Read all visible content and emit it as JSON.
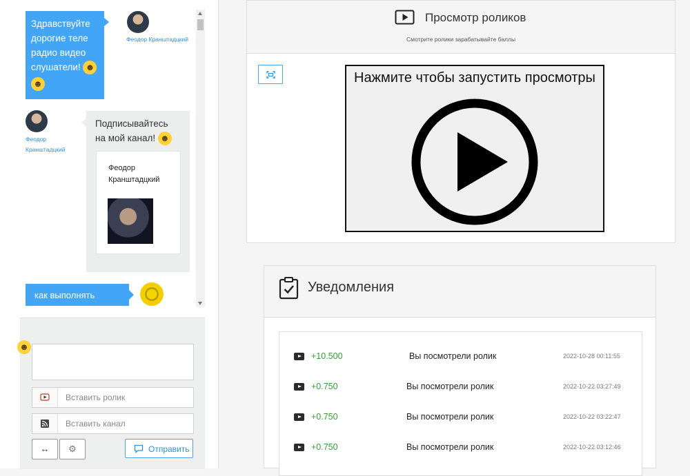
{
  "chat": {
    "messages": [
      {
        "text": "Здравствуйте дорогие теле радио видео слушатели!",
        "author": "Феодор Кранштадцкий"
      },
      {
        "text": "Подписывайтесь на мой канал!",
        "author": "Феодор Кранштадцкий",
        "card": {
          "name": "Феодор Кранштадцкий"
        }
      },
      {
        "text": "как выполнять"
      }
    ],
    "input": {
      "text_placeholder": ""
    },
    "video_input": {
      "placeholder": "Вставить ролик"
    },
    "channel_input": {
      "placeholder": "Вставить канал"
    },
    "buttons": {
      "expand": "↔",
      "settings": "⚙",
      "send": "Отправить"
    }
  },
  "video": {
    "title": "Просмотр роликов",
    "subtitle": "Смотрите ролики зарабатывайте баллы",
    "player_caption": "Нажмите чтобы запустить просмотры"
  },
  "notifications": {
    "title": "Уведомления",
    "items": [
      {
        "points": "+10.500",
        "text": "Вы посмотрели ролик",
        "date": "2022-10-28 00:11:55"
      },
      {
        "points": "+0.750",
        "text": "Вы посмотрели ролик",
        "date": "2022-10-22 03:27:49"
      },
      {
        "points": "+0.750",
        "text": "Вы посмотрели ролик",
        "date": "2022-10-22 03:22:47"
      },
      {
        "points": "+0.750",
        "text": "Вы посмотрели ролик",
        "date": "2022-10-22 03:12:46"
      }
    ]
  },
  "colors": {
    "accent": "#42a5f5",
    "points": "#3a9a3a",
    "emoji": "#ffd23a"
  },
  "icons": [
    "youtube-icon",
    "rss-icon",
    "expand-icon",
    "gear-icon",
    "chat-icon",
    "play-icon",
    "clipboard-check-icon",
    "fullscreen-icon"
  ]
}
